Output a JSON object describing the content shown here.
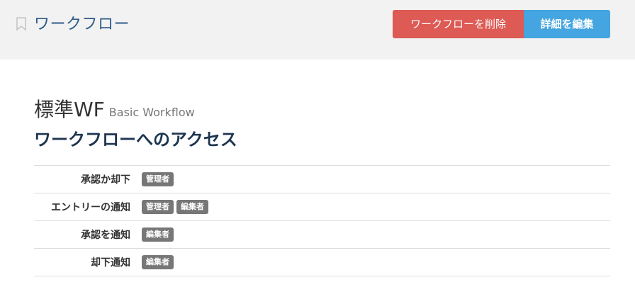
{
  "header": {
    "title": "ワークフロー",
    "delete_label": "ワークフローを削除",
    "edit_label": "詳細を編集"
  },
  "workflow": {
    "name": "標準WF",
    "subtitle": "Basic Workflow",
    "section_title": "ワークフローへのアクセス"
  },
  "access": [
    {
      "label": "承認か却下",
      "roles": [
        "管理者"
      ]
    },
    {
      "label": "エントリーの通知",
      "roles": [
        "管理者",
        "編集者"
      ]
    },
    {
      "label": "承認を通知",
      "roles": [
        "編集者"
      ]
    },
    {
      "label": "却下通知",
      "roles": [
        "編集者"
      ]
    }
  ],
  "colors": {
    "delete": "#dd5a55",
    "edit": "#44a5e0",
    "badge": "#777777",
    "title": "#2f5b8a"
  }
}
